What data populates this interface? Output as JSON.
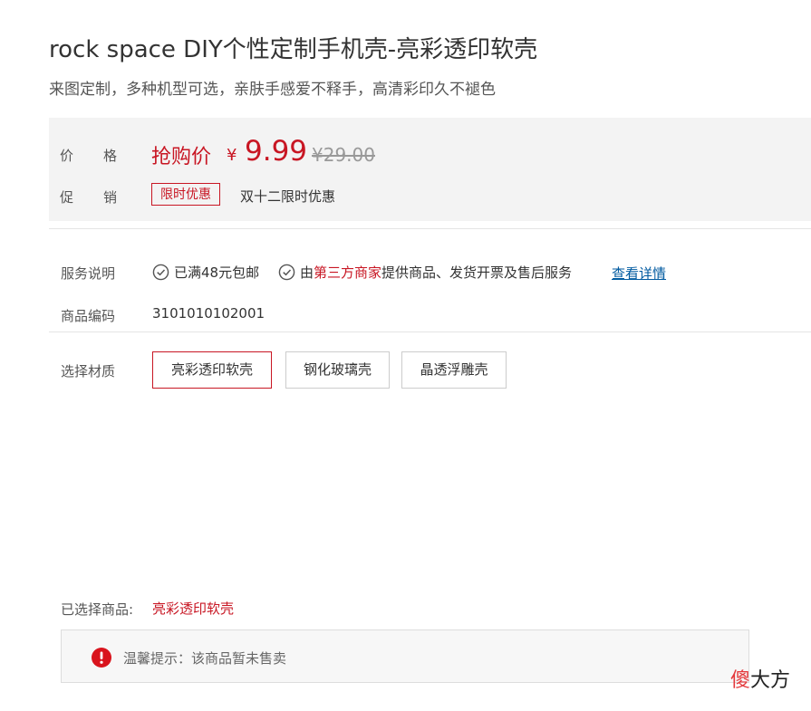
{
  "product": {
    "title": "rock space DIY个性定制手机壳-亮彩透印软壳",
    "subtitle": "来图定制，多种机型可选，亲肤手感爱不释手，高清彩印久不褪色"
  },
  "price_panel": {
    "price_label": [
      "价",
      "格"
    ],
    "flash_sale_word": "抢购价",
    "currency_symbol": "¥",
    "current_price": "9.99",
    "original_price": "¥29.00",
    "promo_label": [
      "促",
      "销"
    ],
    "promo_tag": "限时优惠",
    "promo_text": "双十二限时优惠",
    "accent_color": "#c81623"
  },
  "service": {
    "label": "服务说明",
    "item1": "已满48元包邮",
    "item2_prefix": "由",
    "item2_highlight": "第三方商家",
    "item2_suffix": "提供商品、发货开票及售后服务",
    "detail_link": "查看详情"
  },
  "product_code": {
    "label": "商品编码",
    "value": "3101010102001"
  },
  "material": {
    "label": "选择材质",
    "options": [
      "亮彩透印软壳",
      "钢化玻璃壳",
      "晶透浮雕壳"
    ],
    "selected": "亮彩透印软壳"
  },
  "selection": {
    "label": "已选择商品:",
    "value": "亮彩透印软壳"
  },
  "notice": {
    "icon": "exclamation-icon",
    "text": "温馨提示：该商品暂未售卖"
  },
  "watermark": {
    "part1": "傻",
    "part2": "大方"
  }
}
